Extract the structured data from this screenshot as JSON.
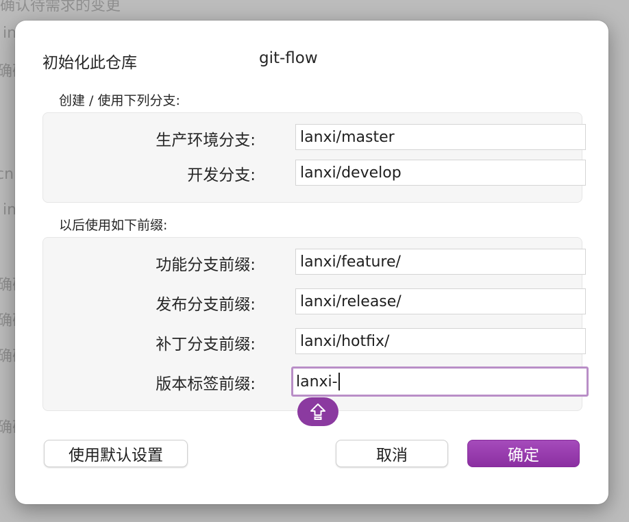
{
  "background": {
    "fragments": [
      "确认待需求的变更",
      "in",
      "确确",
      "cn",
      "in",
      "确确",
      "确确",
      "确确",
      "确确"
    ]
  },
  "dialog": {
    "title": "初始化此仓库",
    "title_value": "git-flow",
    "branches_section_label": "创建 / 使用下列分支:",
    "branches": [
      {
        "label": "生产环境分支:",
        "value": "lanxi/master"
      },
      {
        "label": "开发分支:",
        "value": "lanxi/develop"
      }
    ],
    "prefixes_section_label": "以后使用如下前缀:",
    "prefixes": [
      {
        "label": "功能分支前缀:",
        "value": "lanxi/feature/"
      },
      {
        "label": "发布分支前缀:",
        "value": "lanxi/release/"
      },
      {
        "label": "补丁分支前缀:",
        "value": "lanxi/hotfix/"
      },
      {
        "label": "版本标签前缀:",
        "value": "lanxi-"
      }
    ],
    "caps_lock_icon": "caps-lock-icon",
    "buttons": {
      "use_defaults": "使用默认设置",
      "cancel": "取消",
      "ok": "确定"
    }
  },
  "colors": {
    "accent": "#8b2fa1",
    "focus_ring": "#b98ec7",
    "caps_badge": "#8b3aa0"
  }
}
